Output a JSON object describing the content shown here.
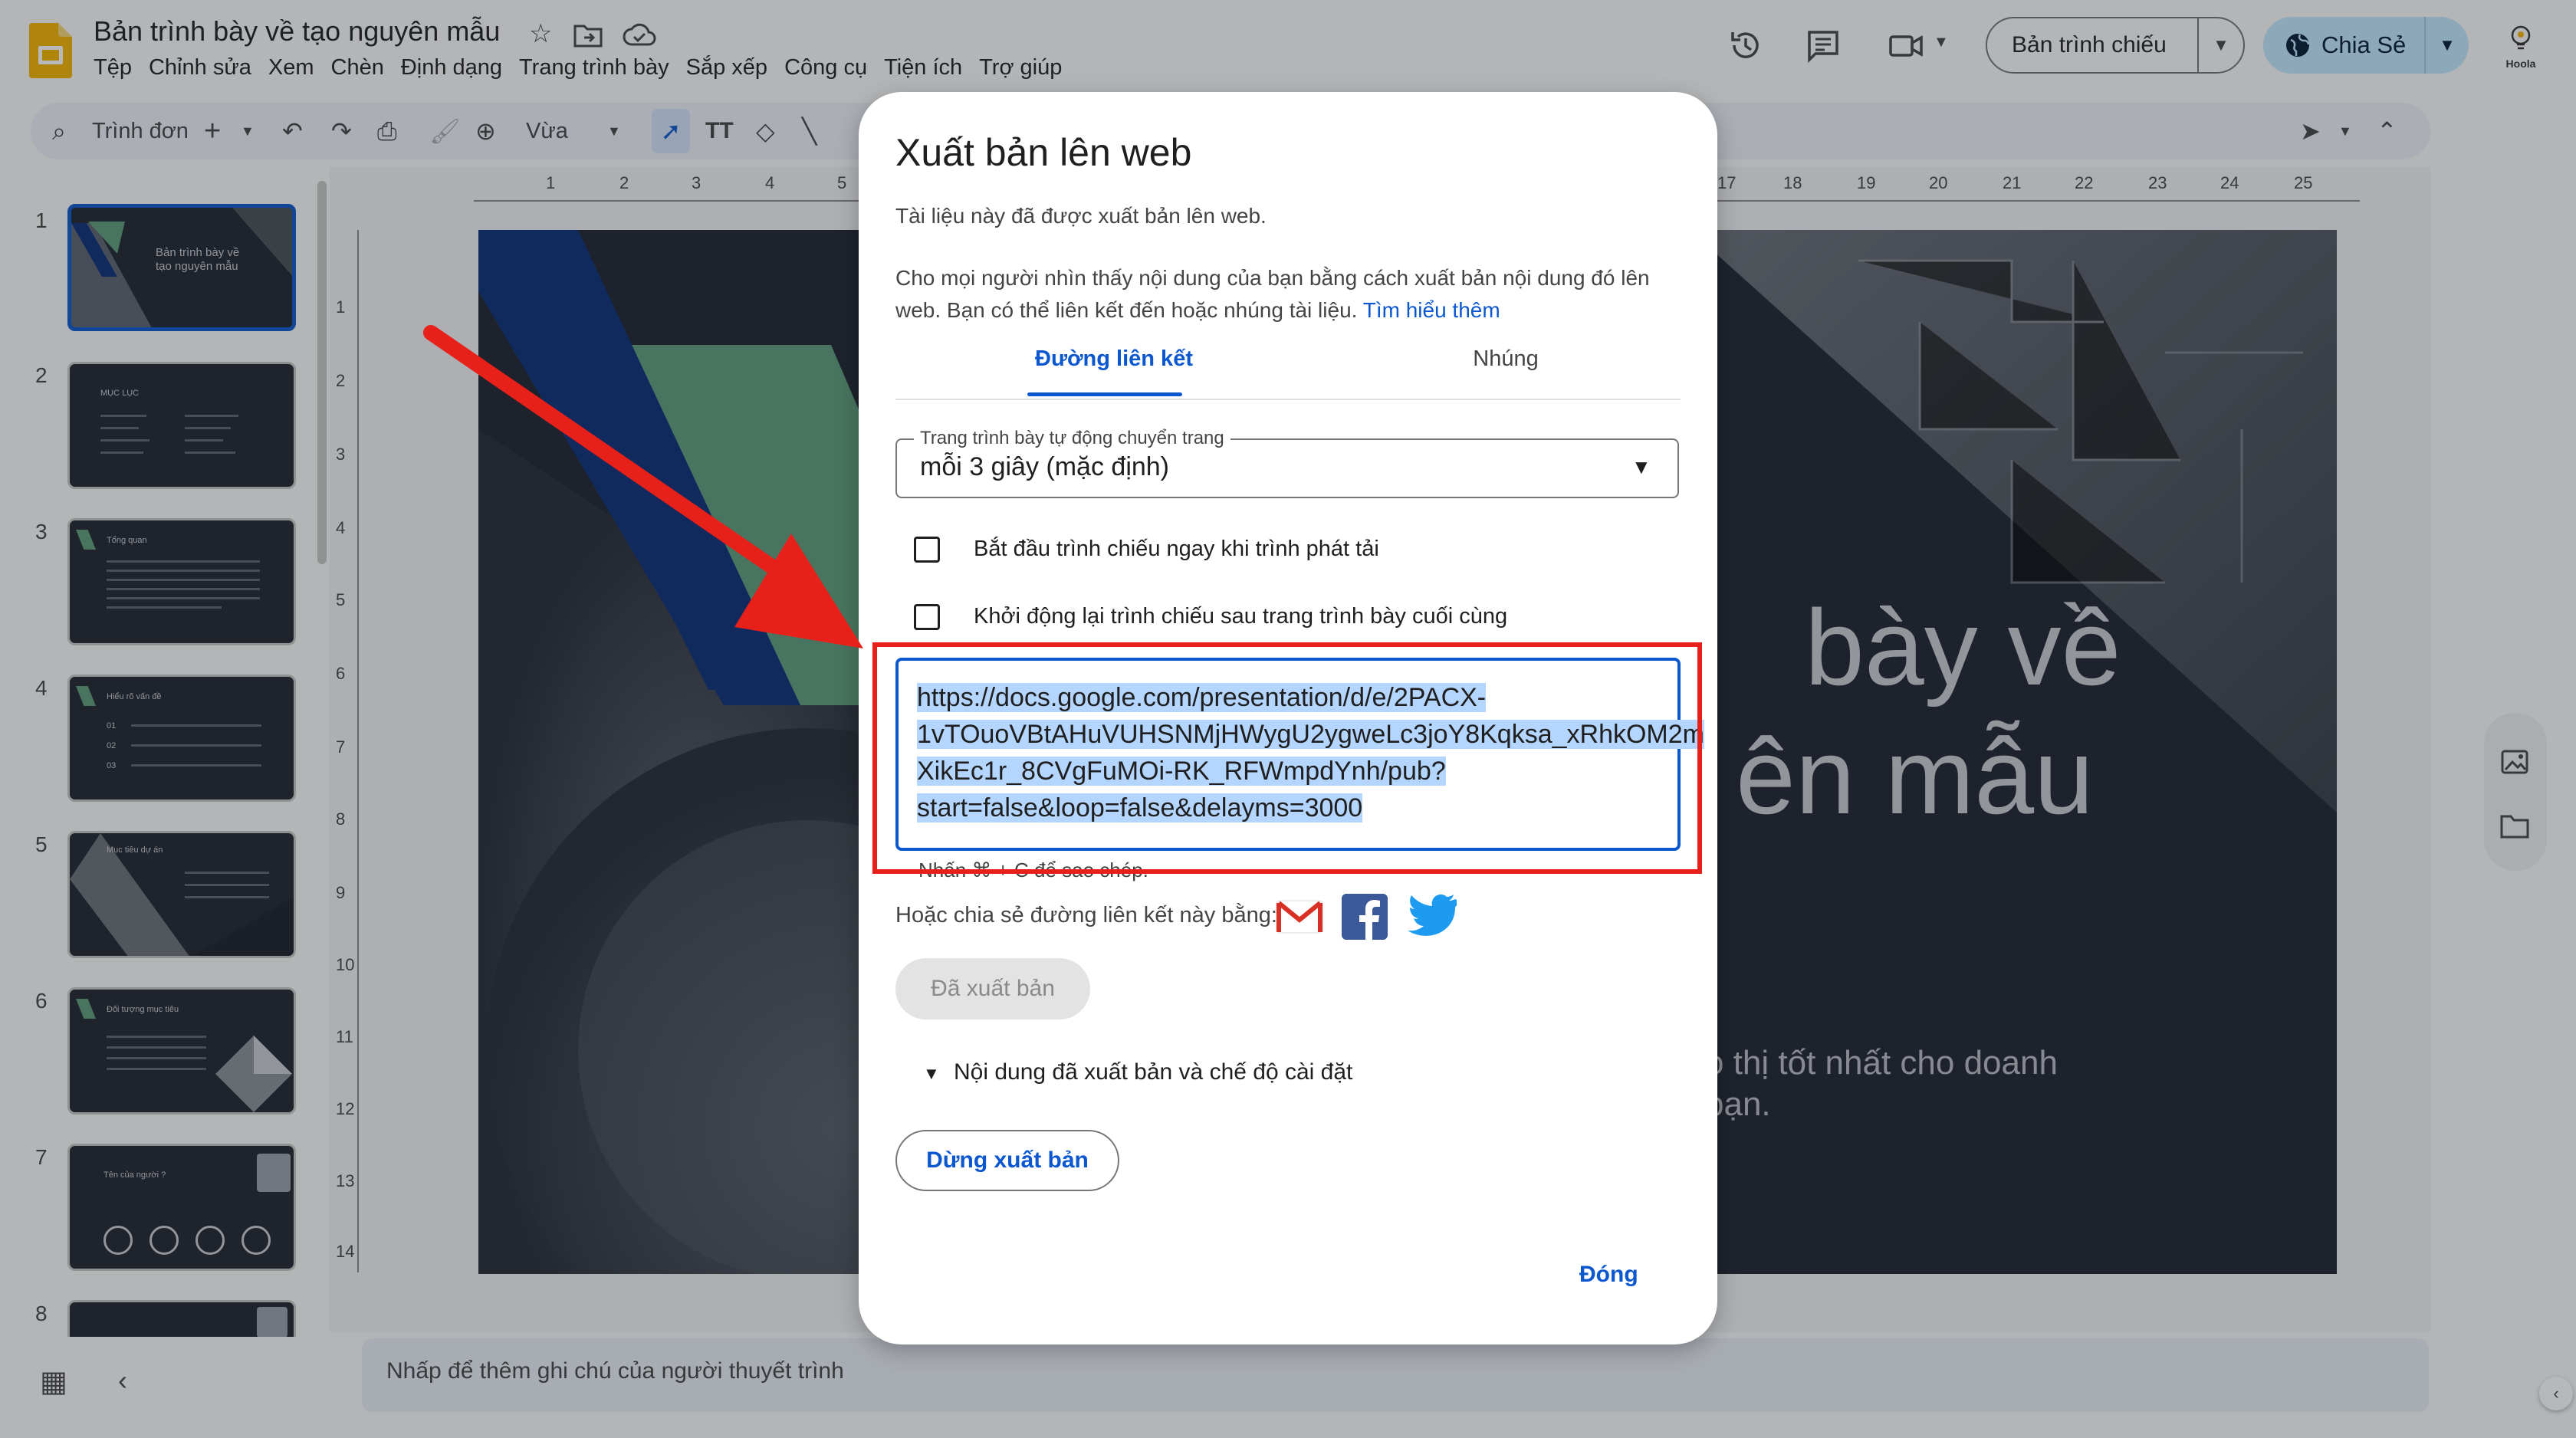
{
  "header": {
    "doc_title": "Bản trình bày về tạo nguyên mẫu",
    "menu": [
      "Tệp",
      "Chỉnh sửa",
      "Xem",
      "Chèn",
      "Định dạng",
      "Trang trình bày",
      "Sắp xếp",
      "Công cụ",
      "Tiện ích",
      "Trợ giúp"
    ],
    "present_label": "Bản trình chiếu",
    "share_label": "Chia Sẻ",
    "brand_label": "Hoola"
  },
  "toolbar": {
    "menu_search": "Trình đơn",
    "zoom_label": "Vừa"
  },
  "filmstrip": {
    "slide_numbers": [
      "1",
      "2",
      "3",
      "4",
      "5",
      "6",
      "7",
      "8"
    ],
    "slide1_title": "Bản trình bày về tạo nguyên mẫu",
    "slide2_title": "MỤC LỤC",
    "slide3_title": "Tổng quan",
    "slide4_title": "Hiểu rõ vấn đề",
    "slide4_numbers": [
      "01",
      "02",
      "03"
    ],
    "slide5_title": "Mục tiêu dự án",
    "slide6_title": "Đối tượng mục tiêu",
    "slide7_title": "Tên của người ?"
  },
  "ruler": {
    "h_ticks": [
      "1",
      "2",
      "3",
      "4",
      "5",
      "17",
      "18",
      "19",
      "20",
      "21",
      "22",
      "23",
      "24",
      "25"
    ],
    "v_ticks": [
      "1",
      "2",
      "3",
      "4",
      "5",
      "6",
      "7",
      "8",
      "9",
      "10",
      "11",
      "12",
      "13",
      "14"
    ]
  },
  "slide": {
    "title_line1": "bày về",
    "title_line2": "ên mẫu",
    "subtitle_line1": "o thị tốt nhất cho doanh",
    "subtitle_line2": "bạn."
  },
  "notes": {
    "placeholder": "Nhấp để thêm ghi chú của người thuyết trình"
  },
  "dialog": {
    "title": "Xuất bản lên web",
    "published_status": "Tài liệu này đã được xuất bản lên web.",
    "description": "Cho mọi người nhìn thấy nội dung của bạn bằng cách xuất bản nội dung đó lên web. Bạn có thể liên kết đến hoặc nhúng tài liệu.",
    "learn_more": "Tìm hiểu thêm",
    "tabs": [
      "Đường liên kết",
      "Nhúng"
    ],
    "select_label": "Trang trình bày tự động chuyển trang",
    "select_value": "mỗi 3 giây (mặc định)",
    "checkbox_start": "Bắt đầu trình chiếu ngay khi trình phát tải",
    "checkbox_restart": "Khởi động lại trình chiếu sau trang trình bày cuối cùng",
    "url_lines": [
      "https://docs.google.com/presentation/d/e/2PACX-",
      "1vTOuoVBtAHuVUHSNMjHWygU2ygweLc3joY8Kqksa_xRhkOM2m",
      "XikEc1r_8CVgFuMOi-RK_RFWmpdYnh/pub?",
      "start=false&loop=false&delayms=3000"
    ],
    "copy_hint": "Nhấn ⌘ + C để sao chép.",
    "share_via": "Hoặc chia sẻ đường liên kết này bằng:",
    "published_button": "Đã xuất bản",
    "settings_toggle": "Nội dung đã xuất bản và chế độ cài đặt",
    "stop_button": "Dừng xuất bản",
    "close_button": "Đóng"
  },
  "colors": {
    "accent_blue": "#0b57d0",
    "share_bg": "#c2e7ff",
    "annotation_red": "#e8201a",
    "slide_bg": "#1d2230",
    "slide_green": "#5e9c7c",
    "slide_navy": "#0a2f7a"
  }
}
